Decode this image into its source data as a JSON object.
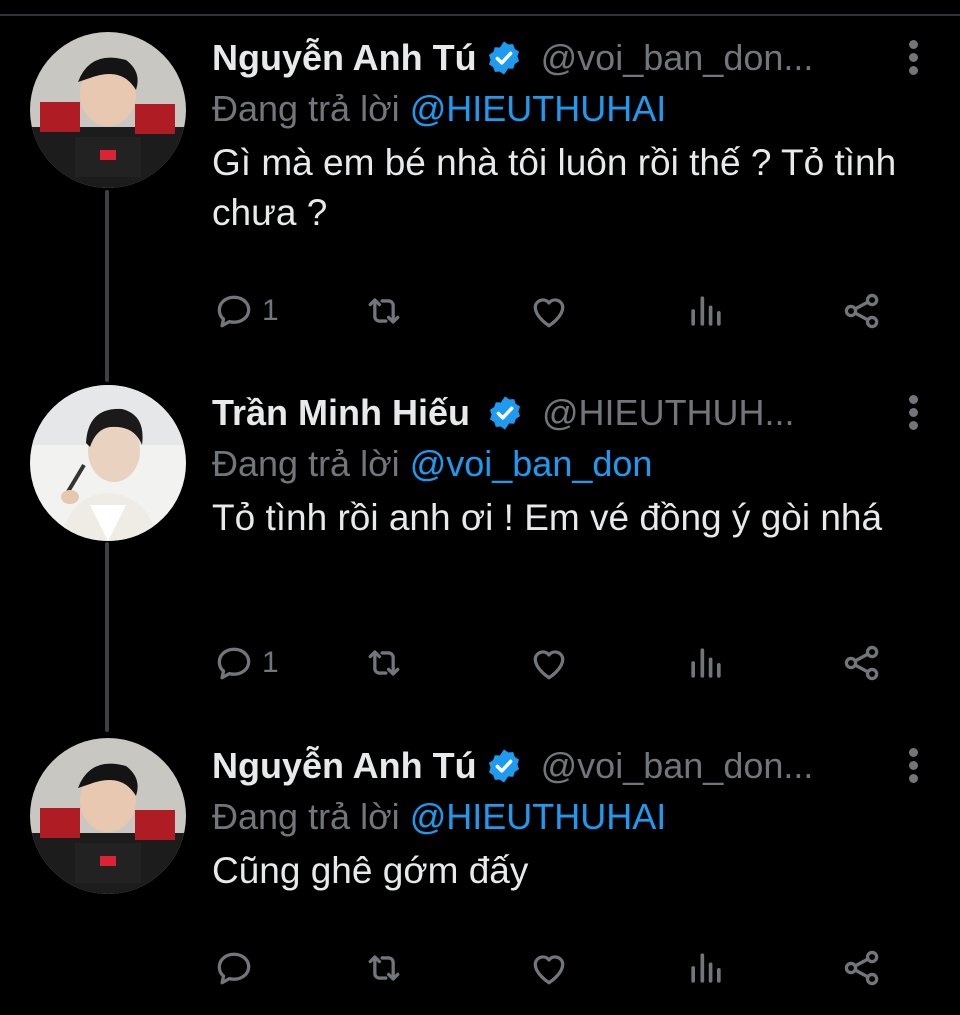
{
  "colors": {
    "background": "#000000",
    "text": "#e7e9ea",
    "secondary": "#71767b",
    "accent": "#1d9bf0",
    "thread_line": "#3d4145"
  },
  "tweets": [
    {
      "name": "Nguyễn Anh Tú",
      "verified": true,
      "handle": "@voi_ban_don...",
      "reply_prefix": "Đang trả lời ",
      "reply_to": "@HIEUTHUHAI",
      "text": "Gì mà em bé nhà tôi luôn rồi thế ? Tỏ tình chưa ?",
      "reply_count": "1",
      "avatar_icon": "avatar-photo"
    },
    {
      "name": "Trần Minh Hiếu",
      "verified": true,
      "handle": "@HIEUTHUH...",
      "reply_prefix": "Đang trả lời ",
      "reply_to": "@voi_ban_don",
      "text": "Tỏ tình rồi anh ơi ! Em vé đồng ý gòi nhá",
      "reply_count": "1",
      "avatar_icon": "avatar-photo"
    },
    {
      "name": "Nguyễn Anh Tú",
      "verified": true,
      "handle": "@voi_ban_don...",
      "reply_prefix": "Đang trả lời ",
      "reply_to": "@HIEUTHUHAI",
      "text": "Cũng ghê gớm đấy",
      "reply_count": "",
      "avatar_icon": "avatar-photo"
    }
  ],
  "action_icons": [
    "reply-icon",
    "retweet-icon",
    "like-icon",
    "views-icon",
    "share-icon"
  ]
}
